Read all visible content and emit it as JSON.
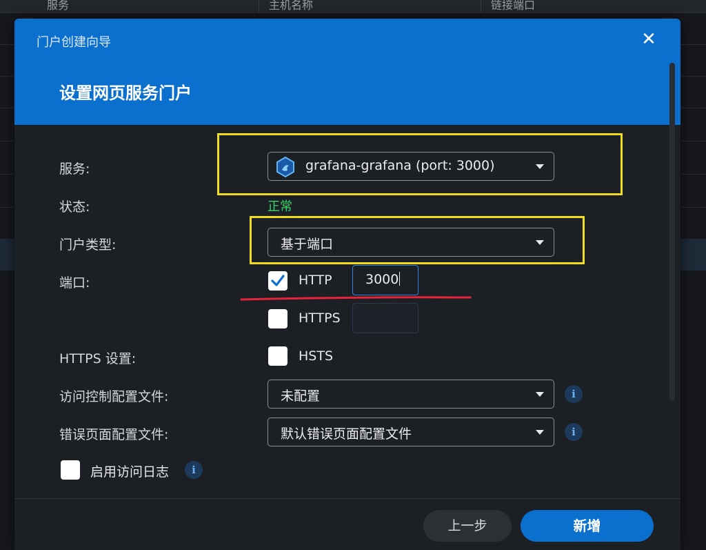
{
  "background": {
    "columns": [
      "服务",
      "主机名称",
      "链接端口"
    ]
  },
  "wizard": {
    "title": "门户创建向导",
    "page_title": "设置网页服务门户"
  },
  "form": {
    "service_label": "服务:",
    "service_value": "grafana-grafana (port: 3000)",
    "status_label": "状态:",
    "status_value": "正常",
    "portal_type_label": "门户类型:",
    "portal_type_value": "基于端口",
    "port_label": "端口:",
    "http_label": "HTTP",
    "http_checked": true,
    "http_port": "3000",
    "https_label": "HTTPS",
    "https_checked": false,
    "https_port": "",
    "https_settings_label": "HTTPS 设置:",
    "hsts_label": "HSTS",
    "hsts_checked": false,
    "access_control_label": "访问控制配置文件:",
    "access_control_value": "未配置",
    "error_page_label": "错误页面配置文件:",
    "error_page_value": "默认错误页面配置文件",
    "access_log_label": "启用访问日志",
    "access_log_checked": false
  },
  "footer": {
    "prev_label": "上一步",
    "add_label": "新增"
  },
  "colors": {
    "accent": "#0b6fce",
    "status_ok": "#37d46a",
    "annotation_box": "#f2dc1f",
    "annotation_underline": "#e8243c"
  },
  "icons": {
    "close": "close-icon",
    "service": "grafana-hexagon-icon",
    "dropdown": "caret-down-icon",
    "info": "info-icon",
    "check": "checkmark-icon"
  }
}
